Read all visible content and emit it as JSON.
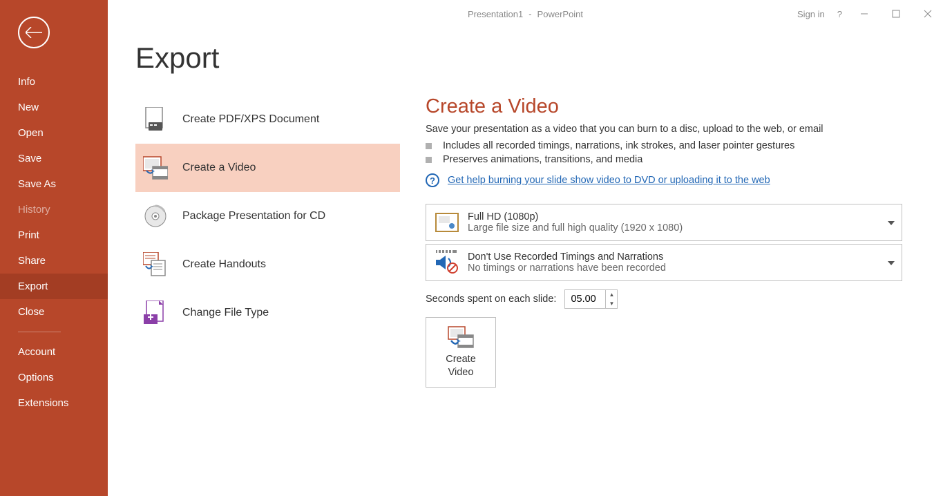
{
  "titlebar": {
    "doc_name": "Presentation1",
    "separator": "-",
    "app_name": "PowerPoint",
    "sign_in": "Sign in",
    "help": "?"
  },
  "sidebar": {
    "items": [
      {
        "label": "Info"
      },
      {
        "label": "New"
      },
      {
        "label": "Open"
      },
      {
        "label": "Save"
      },
      {
        "label": "Save As"
      },
      {
        "label": "History"
      },
      {
        "label": "Print"
      },
      {
        "label": "Share"
      },
      {
        "label": "Export"
      },
      {
        "label": "Close"
      }
    ],
    "bottom": [
      {
        "label": "Account"
      },
      {
        "label": "Options"
      },
      {
        "label": "Extensions"
      }
    ]
  },
  "page_title": "Export",
  "export_options": [
    {
      "label": "Create PDF/XPS Document"
    },
    {
      "label": "Create a Video"
    },
    {
      "label": "Package Presentation for CD"
    },
    {
      "label": "Create Handouts"
    },
    {
      "label": "Change File Type"
    }
  ],
  "detail": {
    "heading": "Create a Video",
    "subtext": "Save your presentation as a video that you can burn to a disc, upload to the web, or email",
    "bullets": [
      "Includes all recorded timings, narrations, ink strokes, and laser pointer gestures",
      "Preserves animations, transitions, and media"
    ],
    "help_link": "Get help burning your slide show video to DVD or uploading it to the web",
    "quality": {
      "title": "Full HD (1080p)",
      "desc": "Large file size and full high quality (1920 x 1080)"
    },
    "timings": {
      "title": "Don't Use Recorded Timings and Narrations",
      "desc": "No timings or narrations have been recorded"
    },
    "seconds_label": "Seconds spent on each slide:",
    "seconds_value": "05.00",
    "create_button_l1": "Create",
    "create_button_l2": "Video"
  }
}
